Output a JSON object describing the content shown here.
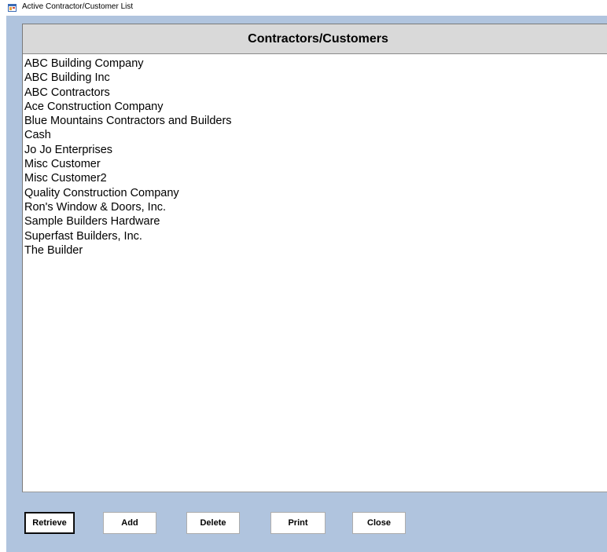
{
  "window": {
    "title": "Active Contractor/Customer List"
  },
  "list": {
    "header": "Contractors/Customers",
    "items": [
      "ABC Building Company",
      "ABC Building Inc",
      "ABC Contractors",
      "Ace Construction Company",
      "Blue Mountains Contractors and Builders",
      "Cash",
      "Jo Jo Enterprises",
      "Misc Customer",
      "Misc Customer2",
      "Quality Construction Company",
      "Ron's Window & Doors, Inc.",
      "Sample Builders Hardware",
      "Superfast Builders, Inc.",
      "The Builder"
    ]
  },
  "buttons": {
    "retrieve": "Retrieve",
    "add": "Add",
    "delete": "Delete",
    "print": "Print",
    "close": "Close"
  },
  "colors": {
    "window_background": "#b0c4de",
    "header_background": "#d9d9d9",
    "list_background": "#ffffff"
  },
  "icons": {
    "app": "application-window-icon"
  }
}
